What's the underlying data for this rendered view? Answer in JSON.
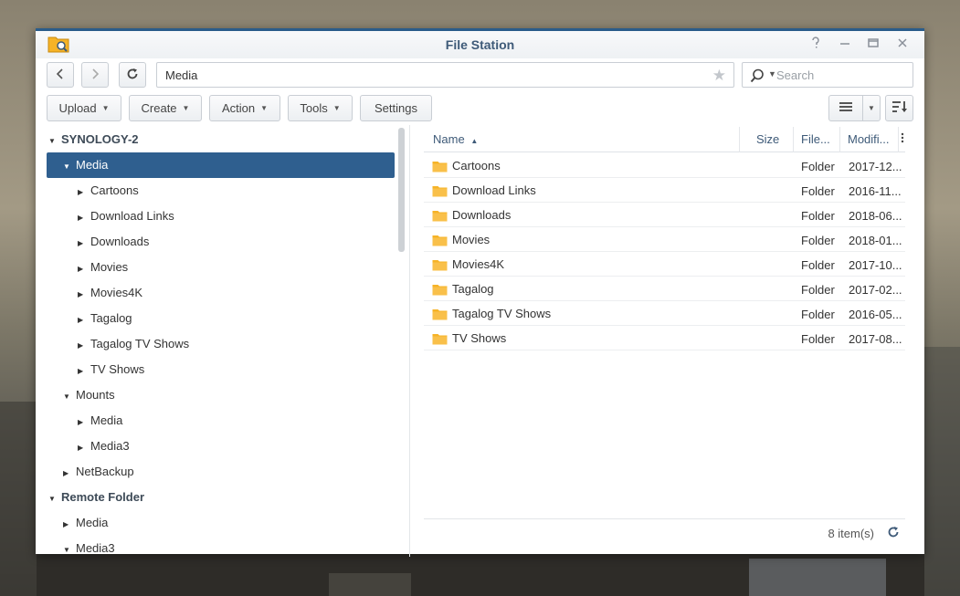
{
  "window": {
    "title": "File Station",
    "app_icon": "folder-search-icon"
  },
  "controls": {
    "help": "help-icon",
    "minimize": "minimize-icon",
    "maximize": "maximize-icon",
    "close": "close-icon"
  },
  "navigation": {
    "back_icon": "chevron-left-icon",
    "forward_icon": "chevron-right-icon",
    "refresh_icon": "refresh-icon"
  },
  "path": {
    "value": "Media",
    "favorite_icon": "star-icon"
  },
  "search": {
    "placeholder": "Search",
    "icon": "search-icon"
  },
  "toolbar": {
    "upload": "Upload",
    "create": "Create",
    "action": "Action",
    "tools": "Tools",
    "settings": "Settings",
    "view_icon": "list-view-icon",
    "sort_icon": "sort-icon"
  },
  "tree": [
    {
      "label": "SYNOLOGY-2",
      "level": 0,
      "expanded": true,
      "bold": true
    },
    {
      "label": "Media",
      "level": 1,
      "expanded": true,
      "selected": true
    },
    {
      "label": "Cartoons",
      "level": 2,
      "expanded": false
    },
    {
      "label": "Download Links",
      "level": 2,
      "expanded": false
    },
    {
      "label": "Downloads",
      "level": 2,
      "expanded": false
    },
    {
      "label": "Movies",
      "level": 2,
      "expanded": false
    },
    {
      "label": "Movies4K",
      "level": 2,
      "expanded": false
    },
    {
      "label": "Tagalog",
      "level": 2,
      "expanded": false
    },
    {
      "label": "Tagalog TV Shows",
      "level": 2,
      "expanded": false
    },
    {
      "label": "TV Shows",
      "level": 2,
      "expanded": false
    },
    {
      "label": "Mounts",
      "level": 1,
      "expanded": true
    },
    {
      "label": "Media",
      "level": 2,
      "expanded": false
    },
    {
      "label": "Media3",
      "level": 2,
      "expanded": false
    },
    {
      "label": "NetBackup",
      "level": 1,
      "expanded": false
    },
    {
      "label": "Remote Folder",
      "level": 0,
      "expanded": true,
      "bold": true
    },
    {
      "label": "Media",
      "level": 1,
      "expanded": false
    },
    {
      "label": "Media3",
      "level": 1,
      "expanded": true
    }
  ],
  "grid": {
    "columns": {
      "name": "Name",
      "size": "Size",
      "type": "File...",
      "modified": "Modifi..."
    },
    "sort_indicator": "▲",
    "rows": [
      {
        "name": "Cartoons",
        "size": "",
        "type": "Folder",
        "modified": "2017-12..."
      },
      {
        "name": "Download Links",
        "size": "",
        "type": "Folder",
        "modified": "2016-11..."
      },
      {
        "name": "Downloads",
        "size": "",
        "type": "Folder",
        "modified": "2018-06..."
      },
      {
        "name": "Movies",
        "size": "",
        "type": "Folder",
        "modified": "2018-01..."
      },
      {
        "name": "Movies4K",
        "size": "",
        "type": "Folder",
        "modified": "2017-10..."
      },
      {
        "name": "Tagalog",
        "size": "",
        "type": "Folder",
        "modified": "2017-02..."
      },
      {
        "name": "Tagalog TV Shows",
        "size": "",
        "type": "Folder",
        "modified": "2016-05..."
      },
      {
        "name": "TV Shows",
        "size": "",
        "type": "Folder",
        "modified": "2017-08..."
      }
    ]
  },
  "status": {
    "count": "8 item(s)"
  },
  "colors": {
    "accent": "#2f5f8f",
    "folder": "#f6b327",
    "title": "#3e5a78"
  }
}
